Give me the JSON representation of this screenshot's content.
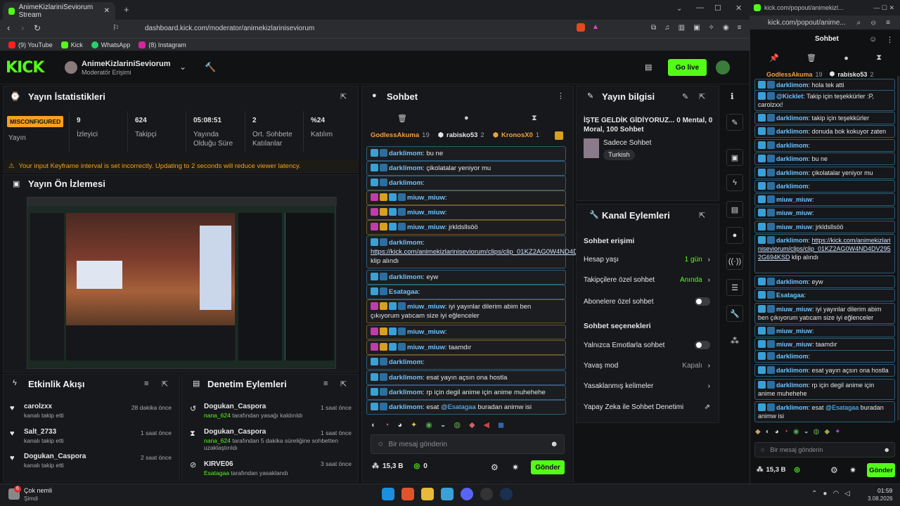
{
  "browser": {
    "tab_title": "AnimeKizlariniSeviorum Stream",
    "url": "dashboard.kick.com/moderator/animekizlariniseviorum",
    "bookmarks": [
      "(9) YouTube",
      "Kick",
      "WhatsApp",
      "(8) Instagram"
    ],
    "popout_title": "kick.com/popout/animekizl...",
    "popout_url": "kick.com/popout/anime..."
  },
  "header": {
    "channel": "AnimeKizlariniSeviorum",
    "role": "Moderatör Erişimi",
    "go_live": "Go live"
  },
  "stats": {
    "title": "Yayın İstatistikleri",
    "status_badge": "MISCONFIGURED",
    "status_label": "Yayın",
    "items": [
      {
        "value": "9",
        "label": "İzleyici"
      },
      {
        "value": "624",
        "label": "Takipçi"
      },
      {
        "value": "05:08:51",
        "label": "Yayında Olduğu Süre"
      },
      {
        "value": "2",
        "label": "Ort. Sohbete Katılanlar"
      },
      {
        "value": "%24",
        "label": "Katılım"
      }
    ],
    "warning": "Your input Keyframe interval is set incorrectly. Updating to 2 seconds will reduce viewer latency."
  },
  "preview": {
    "title": "Yayın Ön İzlemesi"
  },
  "activity": {
    "title": "Etkinlik Akışı",
    "items": [
      {
        "name": "carolzxx",
        "sub": "kanalı takip etti",
        "time": "28 dakika önce"
      },
      {
        "name": "Salt_2733",
        "sub": "kanalı takip etti",
        "time": "1 saat önce"
      },
      {
        "name": "Dogukan_Caspora",
        "sub": "kanalı takip etti",
        "time": "2 saat önce"
      }
    ]
  },
  "mod": {
    "title": "Denetim Eylemleri",
    "items": [
      {
        "name": "Dogukan_Caspora",
        "by": "nana_624",
        "sub": "tarafından yasağı kaldırıldı",
        "time": "1 saat önce"
      },
      {
        "name": "Dogukan_Caspora",
        "by": "nana_624",
        "sub": "tarafından 5 dakika süreliğine sohbetten uzaklaştırıldı",
        "time": "1 saat önce"
      },
      {
        "name": "KIRVE06",
        "by": "Esatagaa",
        "sub": "tarafından yasaklandı",
        "time": "3 saat önce"
      }
    ]
  },
  "chat": {
    "title": "Sohbet",
    "top": [
      {
        "name": "GodlessAkuma",
        "n": "19"
      },
      {
        "name": "rabisko53",
        "n": "2"
      },
      {
        "name": "KronosX0",
        "n": "1"
      }
    ],
    "messages": [
      {
        "user": "darklimom",
        "text": "bu ne"
      },
      {
        "user": "darklimom",
        "text": "çikolatalar yeniyor mu"
      },
      {
        "user": "darklimom",
        "text": ""
      },
      {
        "user": "miuw_miuw",
        "text": ""
      },
      {
        "user": "miuw_miuw",
        "text": ""
      },
      {
        "user": "miuw_miuw",
        "text": "jrkldsllsöö"
      },
      {
        "user": "darklimom",
        "text": "",
        "link": "https://kick.com/animekizlariniseviorum/clips/clip_01KZ2AG0W4ND4DV2952G694KSD",
        "after": " klip alındı"
      },
      {
        "user": "darklimom",
        "text": "eyw"
      },
      {
        "user": "Esatagaa",
        "text": ""
      },
      {
        "user": "miuw_miuw",
        "text": "iyi yayınlar dilerim abim ben çıkıyorum yatıcam size iyi eğlenceler"
      },
      {
        "user": "miuw_miuw",
        "text": ""
      },
      {
        "user": "miuw_miuw",
        "text": "taamdır"
      },
      {
        "user": "darklimom",
        "text": ""
      },
      {
        "user": "darklimom",
        "text": "esat yayın açsın ona hostla"
      },
      {
        "user": "darklimom",
        "text": "rp için degil anime için anime muhehehe"
      },
      {
        "user": "darklimom",
        "text": "esat ",
        "mention": "@Esatagaa",
        "after": " buradan animw isi"
      }
    ],
    "placeholder": "Bir mesaj gönderin",
    "kicks": "15,3 B",
    "zero": "0",
    "send": "Gönder"
  },
  "info": {
    "title": "Yayın bilgisi",
    "stream_title": "İŞTE GELDİK GİDİYORUZ... 0 Mental, 0 Moral, 100 Sohbet",
    "category": "Sadece Sohbet",
    "tag": "Turkish"
  },
  "channel_actions": {
    "title": "Kanal Eylemleri",
    "access_title": "Sohbet erişimi",
    "rows": [
      {
        "label": "Hesap yaşı",
        "value": "1 gün"
      },
      {
        "label": "Takipçilere özel sohbet",
        "value": "Anında"
      },
      {
        "label": "Abonelere özel sohbet",
        "value": ""
      }
    ],
    "options_title": "Sohbet seçenekleri",
    "opts": [
      {
        "label": "Yalnızca Emotlarla sohbet",
        "value": ""
      },
      {
        "label": "Yavaş mod",
        "value": "Kapalı"
      },
      {
        "label": "Yasaklanmış kelimeler",
        "value": ""
      },
      {
        "label": "Yapay Zeka ile Sohbet Denetimi",
        "value": ""
      }
    ]
  },
  "popout": {
    "title": "Sohbet",
    "top": [
      {
        "name": "GodlessAkuma",
        "n": "19"
      },
      {
        "name": "rabisko53",
        "n": "2"
      }
    ],
    "messages": [
      {
        "user": "darklimom",
        "text": "hola tek atti"
      },
      {
        "user": "@Kicklet",
        "text": "Takip için teşekkürler :P, carolzxx!"
      },
      {
        "user": "darklimom",
        "text": "takip için teşekkürler"
      },
      {
        "user": "darklimom",
        "text": "donuda bok kokuyor zaten"
      },
      {
        "user": "darklimom",
        "text": ""
      },
      {
        "user": "darklimom",
        "text": "bu ne"
      },
      {
        "user": "darklimom",
        "text": "çikolatalar yeniyor mu"
      },
      {
        "user": "darklimom",
        "text": ""
      },
      {
        "user": "miuw_miuw",
        "text": ""
      },
      {
        "user": "miuw_miuw",
        "text": ""
      },
      {
        "user": "miuw_miuw",
        "text": "jrkldsllsöö"
      },
      {
        "user": "darklimom",
        "text": "",
        "link": "https://kick.com/animekizlariniseviorum/clips/clip_01KZ2AG0W4ND4DV2952G694KSD",
        "after": " klip alındı"
      },
      {
        "user": "darklimom",
        "text": "eyw"
      },
      {
        "user": "Esatagaa",
        "text": ""
      },
      {
        "user": "miuw_miuw",
        "text": "iyi yayınlar dilerim abim ben çıkıyorum yatıcam size iyi eğlenceler"
      },
      {
        "user": "miuw_miuw",
        "text": ""
      },
      {
        "user": "miuw_miuw",
        "text": "taamdır"
      },
      {
        "user": "darklimom",
        "text": ""
      },
      {
        "user": "darklimom",
        "text": "esat yayın açsın ona hostla"
      },
      {
        "user": "darklimom",
        "text": "rp için degil anime için anime muhehehe"
      },
      {
        "user": "darklimom",
        "text": "esat ",
        "mention": "@Esatagaa",
        "after": " buradan animw isi"
      }
    ],
    "placeholder": "Bir mesaj gönderin",
    "kicks": "15,3 B",
    "send": "Gönder"
  },
  "taskbar": {
    "notif_title": "Çok nemli",
    "notif_sub": "Şimdi",
    "notif_count": "6",
    "time": "01:59",
    "date": "3.08.2026"
  },
  "colors": {
    "brand": "#53fc18",
    "user": "#6cc3ff"
  }
}
